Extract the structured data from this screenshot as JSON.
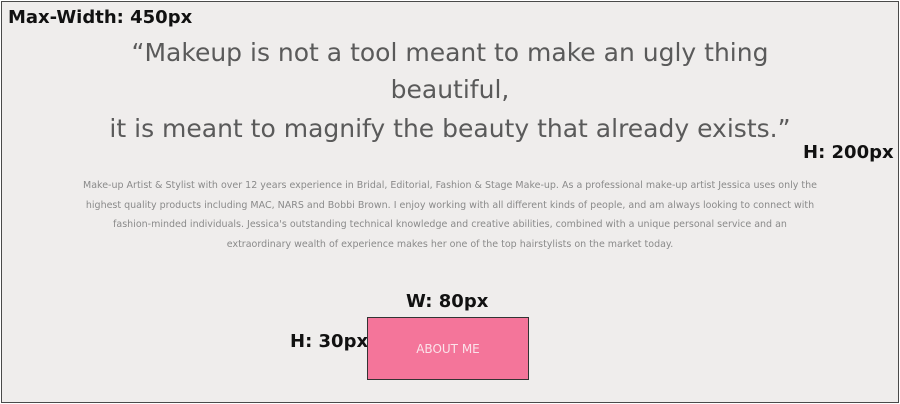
{
  "annotations": {
    "max_width": "Max-Width: 450px",
    "section_height": "H: 200px",
    "button_width": "W: 80px",
    "button_height": "H: 30px"
  },
  "quote": {
    "line1": "“Makeup is not a tool meant to make an ugly thing",
    "line2": "beautiful,",
    "line3": "it is meant to magnify the beauty that already exists.”"
  },
  "bio": {
    "text": "Make-up Artist & Stylist with over 12 years experience in Bridal, Editorial, Fashion & Stage Make-up. As a professional make-up artist Jessica uses only the highest quality products including MAC, NARS and Bobbi Brown. I enjoy working with all different kinds of people, and am always looking to connect with fashion-minded individuals. Jessica's outstanding technical knowledge and creative abilities, combined with a unique personal service and an extraordinary wealth of experience makes her one of the top hairstylists on the market today."
  },
  "button": {
    "label": "ABOUT ME"
  },
  "colors": {
    "background": "#efedec",
    "button": "#f4759a",
    "quote_text": "#5a5a5a",
    "bio_text": "#8a8a8a"
  }
}
